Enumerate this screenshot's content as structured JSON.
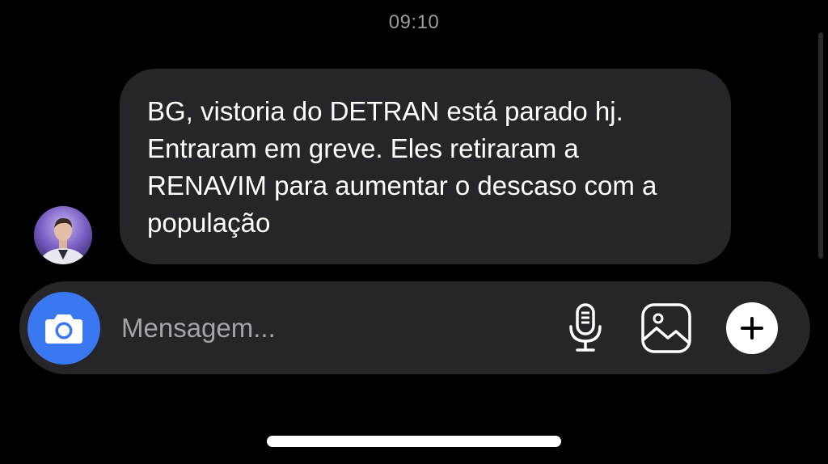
{
  "conversation": {
    "timestamp": "09:10",
    "messages": [
      {
        "direction": "incoming",
        "text": "BG, vistoria do DETRAN está parado hj. Entraram em greve. Eles retiraram a RENAVIM para aumentar o descaso com a população"
      }
    ]
  },
  "composer": {
    "placeholder": "Mensagem...",
    "value": "",
    "camera_icon": "camera-icon",
    "mic_icon": "microphone-icon",
    "gallery_icon": "image-icon",
    "plus_icon": "plus-icon"
  },
  "colors": {
    "background": "#000000",
    "bubble": "#262628",
    "camera_accent": "#3a78f2",
    "timestamp": "#9a9a9f"
  }
}
